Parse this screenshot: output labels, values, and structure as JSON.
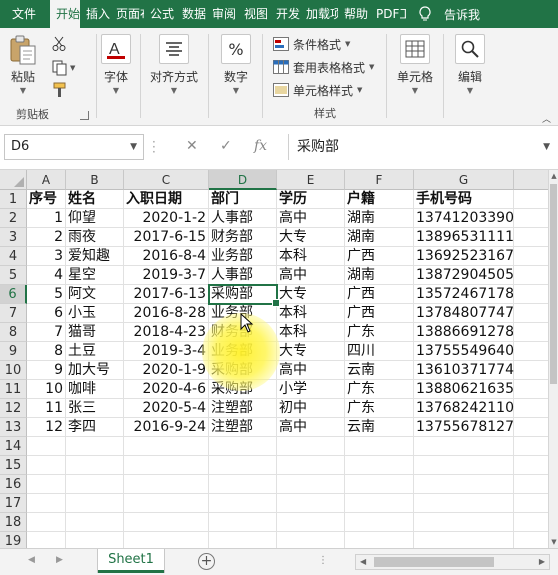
{
  "tabs": [
    {
      "label": "文件",
      "active": false
    },
    {
      "label": "开始",
      "active": true
    },
    {
      "label": "插入",
      "active": false
    },
    {
      "label": "页面布",
      "active": false
    },
    {
      "label": "公式",
      "active": false
    },
    {
      "label": "数据",
      "active": false
    },
    {
      "label": "审阅",
      "active": false
    },
    {
      "label": "视图",
      "active": false
    },
    {
      "label": "开发",
      "active": false
    },
    {
      "label": "加载项",
      "active": false
    },
    {
      "label": "帮助",
      "active": false
    },
    {
      "label": "PDF工",
      "active": false
    }
  ],
  "tell_me": "告诉我",
  "ribbon": {
    "clipboard": {
      "paste": "粘贴",
      "group_label": "剪贴板"
    },
    "font": {
      "label": "字体"
    },
    "alignment": {
      "label": "对齐方式"
    },
    "number": {
      "label": "数字"
    },
    "styles": {
      "conditional": "条件格式",
      "table_format": "套用表格格式",
      "cell_styles": "单元格样式",
      "group_label": "样式"
    },
    "cells": {
      "label": "单元格"
    },
    "editing": {
      "label": "编辑"
    }
  },
  "formula_bar": {
    "name_box": "D6",
    "fx": "fx",
    "content": "采购部"
  },
  "grid": {
    "columns": [
      "A",
      "B",
      "C",
      "D",
      "E",
      "F",
      "G"
    ],
    "row_numbers": [
      "1",
      "2",
      "3",
      "4",
      "5",
      "6",
      "7",
      "8",
      "9",
      "10",
      "11",
      "12",
      "13",
      "14",
      "15",
      "16",
      "17",
      "18",
      "19"
    ],
    "header": [
      "序号",
      "姓名",
      "入职日期",
      "部门",
      "学历",
      "户籍",
      "手机号码"
    ],
    "rows": [
      [
        "1",
        "仰望",
        "2020-1-2",
        "人事部",
        "高中",
        "湖南",
        "13741203390"
      ],
      [
        "2",
        "雨夜",
        "2017-6-15",
        "财务部",
        "大专",
        "湖南",
        "13896531111"
      ],
      [
        "3",
        "爱知趣",
        "2016-8-4",
        "业务部",
        "本科",
        "广西",
        "13692523167"
      ],
      [
        "4",
        "星空",
        "2019-3-7",
        "人事部",
        "高中",
        "湖南",
        "13872904505"
      ],
      [
        "5",
        "阿文",
        "2017-6-13",
        "采购部",
        "大专",
        "广西",
        "13572467178"
      ],
      [
        "6",
        "小玉",
        "2016-8-28",
        "业务部",
        "本科",
        "广西",
        "13784807747"
      ],
      [
        "7",
        "猫哥",
        "2018-4-23",
        "财务部",
        "本科",
        "广东",
        "13886691278"
      ],
      [
        "8",
        "土豆",
        "2019-3-4",
        "业务部",
        "大专",
        "四川",
        "13755549640"
      ],
      [
        "9",
        "加大号",
        "2020-1-9",
        "采购部",
        "高中",
        "云南",
        "13610371774"
      ],
      [
        "10",
        "咖啡",
        "2020-4-6",
        "采购部",
        "小学",
        "广东",
        "13880621635"
      ],
      [
        "11",
        "张三",
        "2020-5-4",
        "注塑部",
        "初中",
        "广东",
        "13768242110"
      ],
      [
        "12",
        "李四",
        "2016-9-24",
        "注塑部",
        "高中",
        "云南",
        "13755678127"
      ]
    ],
    "selected_cell": "D6",
    "accent_color": "#217346"
  },
  "sheets": [
    {
      "label": "Sheet1",
      "active": true
    }
  ],
  "add_sheet": "+",
  "tabs_overflow": "⋮"
}
